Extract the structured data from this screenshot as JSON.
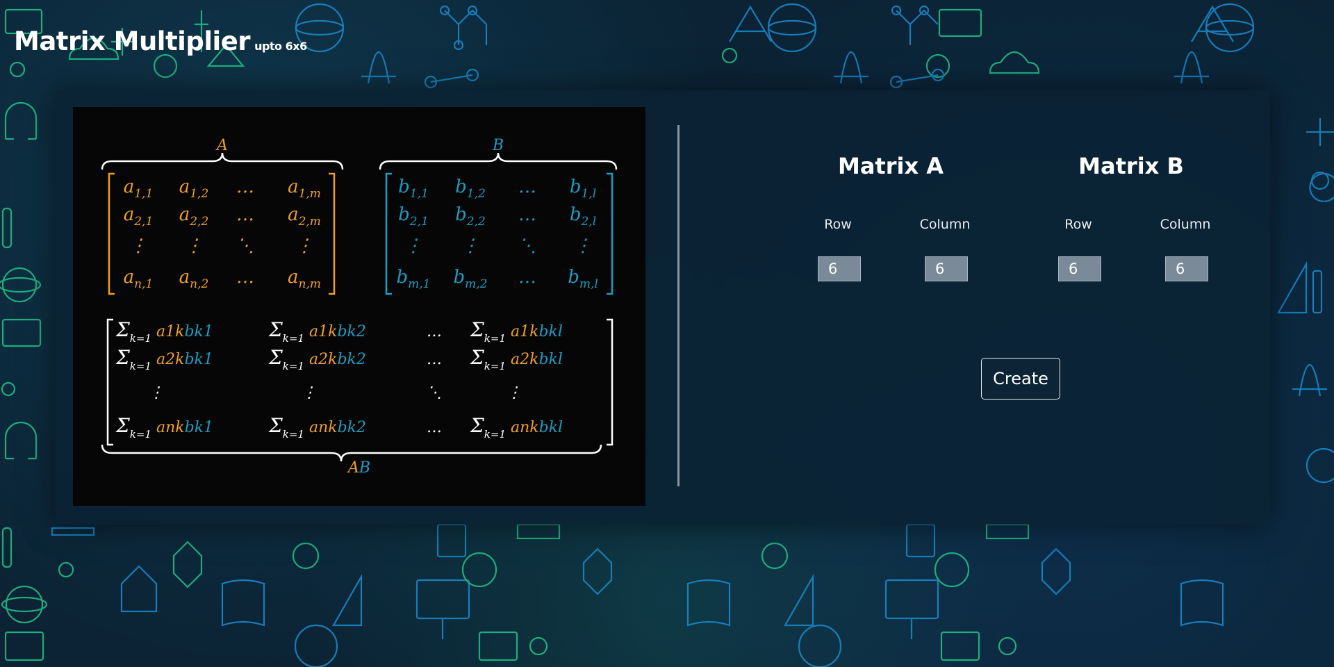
{
  "page": {
    "title": "Matrix Multiplier",
    "subtitle": "upto 6x6"
  },
  "formula": {
    "labels": {
      "a": "A",
      "b": "B",
      "ab": "AB"
    },
    "colors": {
      "a": "#f0a020",
      "b": "#1a9cc4",
      "white": "#ffffff"
    },
    "matrix_a": [
      [
        "a_{1,1}",
        "a_{1,2}",
        "…",
        "a_{1,m}"
      ],
      [
        "a_{2,1}",
        "a_{2,2}",
        "…",
        "a_{2,m}"
      ],
      [
        "⋮",
        "⋮",
        "⋱",
        "⋮"
      ],
      [
        "a_{n,1}",
        "a_{n,2}",
        "…",
        "a_{n,m}"
      ]
    ],
    "matrix_b": [
      [
        "b_{1,1}",
        "b_{1,2}",
        "…",
        "b_{1,l}"
      ],
      [
        "b_{2,1}",
        "b_{2,2}",
        "…",
        "b_{2,l}"
      ],
      [
        "⋮",
        "⋮",
        "⋱",
        "⋮"
      ],
      [
        "b_{m,1}",
        "b_{m,2}",
        "…",
        "b_{m,l}"
      ]
    ],
    "product": [
      [
        "Σ a1k bk1",
        "Σ a1k bk2",
        "…",
        "Σ a1k bkl"
      ],
      [
        "Σ a2k bk1",
        "Σ a2k bk2",
        "…",
        "Σ a2k bkl"
      ],
      [
        "⋮",
        "⋮",
        "⋱",
        "⋮"
      ],
      [
        "Σ ank bk1",
        "Σ ank bk2",
        "…",
        "Σ ank bkl"
      ]
    ]
  },
  "matrix_a": {
    "heading": "Matrix A",
    "row_label": "Row",
    "column_label": "Column",
    "row_value": "6",
    "column_value": "6"
  },
  "matrix_b": {
    "heading": "Matrix B",
    "row_label": "Row",
    "column_label": "Column",
    "row_value": "6",
    "column_value": "6"
  },
  "create_button": {
    "label": "Create"
  },
  "theme": {
    "pattern_green": "#23c48a",
    "pattern_blue": "#1a8ccf"
  }
}
